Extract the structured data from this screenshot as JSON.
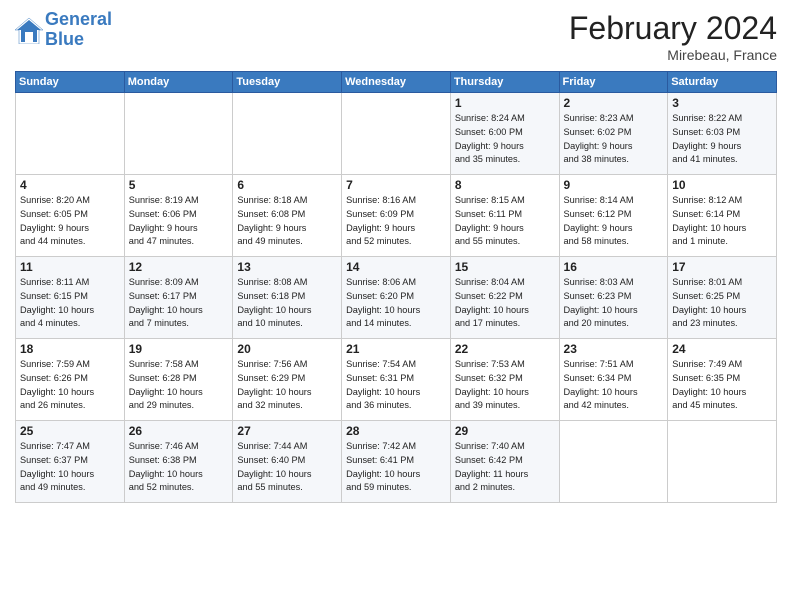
{
  "header": {
    "logo_line1": "General",
    "logo_line2": "Blue",
    "title": "February 2024",
    "location": "Mirebeau, France"
  },
  "columns": [
    "Sunday",
    "Monday",
    "Tuesday",
    "Wednesday",
    "Thursday",
    "Friday",
    "Saturday"
  ],
  "rows": [
    [
      {
        "num": "",
        "info": ""
      },
      {
        "num": "",
        "info": ""
      },
      {
        "num": "",
        "info": ""
      },
      {
        "num": "",
        "info": ""
      },
      {
        "num": "1",
        "info": "Sunrise: 8:24 AM\nSunset: 6:00 PM\nDaylight: 9 hours\nand 35 minutes."
      },
      {
        "num": "2",
        "info": "Sunrise: 8:23 AM\nSunset: 6:02 PM\nDaylight: 9 hours\nand 38 minutes."
      },
      {
        "num": "3",
        "info": "Sunrise: 8:22 AM\nSunset: 6:03 PM\nDaylight: 9 hours\nand 41 minutes."
      }
    ],
    [
      {
        "num": "4",
        "info": "Sunrise: 8:20 AM\nSunset: 6:05 PM\nDaylight: 9 hours\nand 44 minutes."
      },
      {
        "num": "5",
        "info": "Sunrise: 8:19 AM\nSunset: 6:06 PM\nDaylight: 9 hours\nand 47 minutes."
      },
      {
        "num": "6",
        "info": "Sunrise: 8:18 AM\nSunset: 6:08 PM\nDaylight: 9 hours\nand 49 minutes."
      },
      {
        "num": "7",
        "info": "Sunrise: 8:16 AM\nSunset: 6:09 PM\nDaylight: 9 hours\nand 52 minutes."
      },
      {
        "num": "8",
        "info": "Sunrise: 8:15 AM\nSunset: 6:11 PM\nDaylight: 9 hours\nand 55 minutes."
      },
      {
        "num": "9",
        "info": "Sunrise: 8:14 AM\nSunset: 6:12 PM\nDaylight: 9 hours\nand 58 minutes."
      },
      {
        "num": "10",
        "info": "Sunrise: 8:12 AM\nSunset: 6:14 PM\nDaylight: 10 hours\nand 1 minute."
      }
    ],
    [
      {
        "num": "11",
        "info": "Sunrise: 8:11 AM\nSunset: 6:15 PM\nDaylight: 10 hours\nand 4 minutes."
      },
      {
        "num": "12",
        "info": "Sunrise: 8:09 AM\nSunset: 6:17 PM\nDaylight: 10 hours\nand 7 minutes."
      },
      {
        "num": "13",
        "info": "Sunrise: 8:08 AM\nSunset: 6:18 PM\nDaylight: 10 hours\nand 10 minutes."
      },
      {
        "num": "14",
        "info": "Sunrise: 8:06 AM\nSunset: 6:20 PM\nDaylight: 10 hours\nand 14 minutes."
      },
      {
        "num": "15",
        "info": "Sunrise: 8:04 AM\nSunset: 6:22 PM\nDaylight: 10 hours\nand 17 minutes."
      },
      {
        "num": "16",
        "info": "Sunrise: 8:03 AM\nSunset: 6:23 PM\nDaylight: 10 hours\nand 20 minutes."
      },
      {
        "num": "17",
        "info": "Sunrise: 8:01 AM\nSunset: 6:25 PM\nDaylight: 10 hours\nand 23 minutes."
      }
    ],
    [
      {
        "num": "18",
        "info": "Sunrise: 7:59 AM\nSunset: 6:26 PM\nDaylight: 10 hours\nand 26 minutes."
      },
      {
        "num": "19",
        "info": "Sunrise: 7:58 AM\nSunset: 6:28 PM\nDaylight: 10 hours\nand 29 minutes."
      },
      {
        "num": "20",
        "info": "Sunrise: 7:56 AM\nSunset: 6:29 PM\nDaylight: 10 hours\nand 32 minutes."
      },
      {
        "num": "21",
        "info": "Sunrise: 7:54 AM\nSunset: 6:31 PM\nDaylight: 10 hours\nand 36 minutes."
      },
      {
        "num": "22",
        "info": "Sunrise: 7:53 AM\nSunset: 6:32 PM\nDaylight: 10 hours\nand 39 minutes."
      },
      {
        "num": "23",
        "info": "Sunrise: 7:51 AM\nSunset: 6:34 PM\nDaylight: 10 hours\nand 42 minutes."
      },
      {
        "num": "24",
        "info": "Sunrise: 7:49 AM\nSunset: 6:35 PM\nDaylight: 10 hours\nand 45 minutes."
      }
    ],
    [
      {
        "num": "25",
        "info": "Sunrise: 7:47 AM\nSunset: 6:37 PM\nDaylight: 10 hours\nand 49 minutes."
      },
      {
        "num": "26",
        "info": "Sunrise: 7:46 AM\nSunset: 6:38 PM\nDaylight: 10 hours\nand 52 minutes."
      },
      {
        "num": "27",
        "info": "Sunrise: 7:44 AM\nSunset: 6:40 PM\nDaylight: 10 hours\nand 55 minutes."
      },
      {
        "num": "28",
        "info": "Sunrise: 7:42 AM\nSunset: 6:41 PM\nDaylight: 10 hours\nand 59 minutes."
      },
      {
        "num": "29",
        "info": "Sunrise: 7:40 AM\nSunset: 6:42 PM\nDaylight: 11 hours\nand 2 minutes."
      },
      {
        "num": "",
        "info": ""
      },
      {
        "num": "",
        "info": ""
      }
    ]
  ]
}
